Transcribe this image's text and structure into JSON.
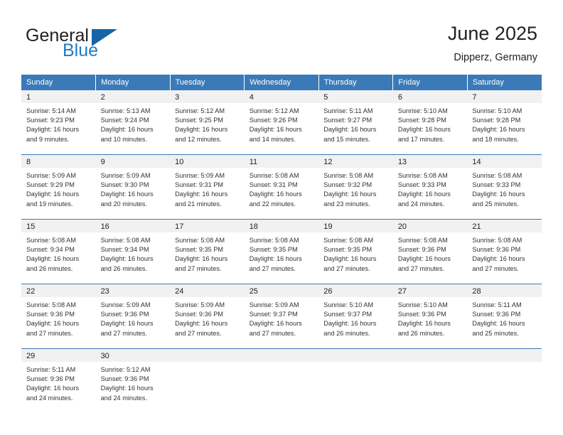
{
  "logo": {
    "word_one": "General",
    "word_two": "Blue",
    "triangle_icon": "triangle-icon"
  },
  "header": {
    "title": "June 2025",
    "subtitle": "Dipperz, Germany"
  },
  "colors": {
    "header_blue": "#3a7ab8",
    "logo_blue": "#1f7bc1",
    "daynum_background": "#f1f1f1",
    "text": "#333333"
  },
  "calendar": {
    "weekday_headers": [
      "Sunday",
      "Monday",
      "Tuesday",
      "Wednesday",
      "Thursday",
      "Friday",
      "Saturday"
    ],
    "labels": {
      "sunrise": "Sunrise:",
      "sunset": "Sunset:",
      "daylight": "Daylight:"
    },
    "weeks": [
      [
        {
          "day": "1",
          "sunrise": "Sunrise: 5:14 AM",
          "sunset": "Sunset: 9:23 PM",
          "daylight_1": "Daylight: 16 hours",
          "daylight_2": "and 9 minutes."
        },
        {
          "day": "2",
          "sunrise": "Sunrise: 5:13 AM",
          "sunset": "Sunset: 9:24 PM",
          "daylight_1": "Daylight: 16 hours",
          "daylight_2": "and 10 minutes."
        },
        {
          "day": "3",
          "sunrise": "Sunrise: 5:12 AM",
          "sunset": "Sunset: 9:25 PM",
          "daylight_1": "Daylight: 16 hours",
          "daylight_2": "and 12 minutes."
        },
        {
          "day": "4",
          "sunrise": "Sunrise: 5:12 AM",
          "sunset": "Sunset: 9:26 PM",
          "daylight_1": "Daylight: 16 hours",
          "daylight_2": "and 14 minutes."
        },
        {
          "day": "5",
          "sunrise": "Sunrise: 5:11 AM",
          "sunset": "Sunset: 9:27 PM",
          "daylight_1": "Daylight: 16 hours",
          "daylight_2": "and 15 minutes."
        },
        {
          "day": "6",
          "sunrise": "Sunrise: 5:10 AM",
          "sunset": "Sunset: 9:28 PM",
          "daylight_1": "Daylight: 16 hours",
          "daylight_2": "and 17 minutes."
        },
        {
          "day": "7",
          "sunrise": "Sunrise: 5:10 AM",
          "sunset": "Sunset: 9:28 PM",
          "daylight_1": "Daylight: 16 hours",
          "daylight_2": "and 18 minutes."
        }
      ],
      [
        {
          "day": "8",
          "sunrise": "Sunrise: 5:09 AM",
          "sunset": "Sunset: 9:29 PM",
          "daylight_1": "Daylight: 16 hours",
          "daylight_2": "and 19 minutes."
        },
        {
          "day": "9",
          "sunrise": "Sunrise: 5:09 AM",
          "sunset": "Sunset: 9:30 PM",
          "daylight_1": "Daylight: 16 hours",
          "daylight_2": "and 20 minutes."
        },
        {
          "day": "10",
          "sunrise": "Sunrise: 5:09 AM",
          "sunset": "Sunset: 9:31 PM",
          "daylight_1": "Daylight: 16 hours",
          "daylight_2": "and 21 minutes."
        },
        {
          "day": "11",
          "sunrise": "Sunrise: 5:08 AM",
          "sunset": "Sunset: 9:31 PM",
          "daylight_1": "Daylight: 16 hours",
          "daylight_2": "and 22 minutes."
        },
        {
          "day": "12",
          "sunrise": "Sunrise: 5:08 AM",
          "sunset": "Sunset: 9:32 PM",
          "daylight_1": "Daylight: 16 hours",
          "daylight_2": "and 23 minutes."
        },
        {
          "day": "13",
          "sunrise": "Sunrise: 5:08 AM",
          "sunset": "Sunset: 9:33 PM",
          "daylight_1": "Daylight: 16 hours",
          "daylight_2": "and 24 minutes."
        },
        {
          "day": "14",
          "sunrise": "Sunrise: 5:08 AM",
          "sunset": "Sunset: 9:33 PM",
          "daylight_1": "Daylight: 16 hours",
          "daylight_2": "and 25 minutes."
        }
      ],
      [
        {
          "day": "15",
          "sunrise": "Sunrise: 5:08 AM",
          "sunset": "Sunset: 9:34 PM",
          "daylight_1": "Daylight: 16 hours",
          "daylight_2": "and 26 minutes."
        },
        {
          "day": "16",
          "sunrise": "Sunrise: 5:08 AM",
          "sunset": "Sunset: 9:34 PM",
          "daylight_1": "Daylight: 16 hours",
          "daylight_2": "and 26 minutes."
        },
        {
          "day": "17",
          "sunrise": "Sunrise: 5:08 AM",
          "sunset": "Sunset: 9:35 PM",
          "daylight_1": "Daylight: 16 hours",
          "daylight_2": "and 27 minutes."
        },
        {
          "day": "18",
          "sunrise": "Sunrise: 5:08 AM",
          "sunset": "Sunset: 9:35 PM",
          "daylight_1": "Daylight: 16 hours",
          "daylight_2": "and 27 minutes."
        },
        {
          "day": "19",
          "sunrise": "Sunrise: 5:08 AM",
          "sunset": "Sunset: 9:35 PM",
          "daylight_1": "Daylight: 16 hours",
          "daylight_2": "and 27 minutes."
        },
        {
          "day": "20",
          "sunrise": "Sunrise: 5:08 AM",
          "sunset": "Sunset: 9:36 PM",
          "daylight_1": "Daylight: 16 hours",
          "daylight_2": "and 27 minutes."
        },
        {
          "day": "21",
          "sunrise": "Sunrise: 5:08 AM",
          "sunset": "Sunset: 9:36 PM",
          "daylight_1": "Daylight: 16 hours",
          "daylight_2": "and 27 minutes."
        }
      ],
      [
        {
          "day": "22",
          "sunrise": "Sunrise: 5:08 AM",
          "sunset": "Sunset: 9:36 PM",
          "daylight_1": "Daylight: 16 hours",
          "daylight_2": "and 27 minutes."
        },
        {
          "day": "23",
          "sunrise": "Sunrise: 5:09 AM",
          "sunset": "Sunset: 9:36 PM",
          "daylight_1": "Daylight: 16 hours",
          "daylight_2": "and 27 minutes."
        },
        {
          "day": "24",
          "sunrise": "Sunrise: 5:09 AM",
          "sunset": "Sunset: 9:36 PM",
          "daylight_1": "Daylight: 16 hours",
          "daylight_2": "and 27 minutes."
        },
        {
          "day": "25",
          "sunrise": "Sunrise: 5:09 AM",
          "sunset": "Sunset: 9:37 PM",
          "daylight_1": "Daylight: 16 hours",
          "daylight_2": "and 27 minutes."
        },
        {
          "day": "26",
          "sunrise": "Sunrise: 5:10 AM",
          "sunset": "Sunset: 9:37 PM",
          "daylight_1": "Daylight: 16 hours",
          "daylight_2": "and 26 minutes."
        },
        {
          "day": "27",
          "sunrise": "Sunrise: 5:10 AM",
          "sunset": "Sunset: 9:36 PM",
          "daylight_1": "Daylight: 16 hours",
          "daylight_2": "and 26 minutes."
        },
        {
          "day": "28",
          "sunrise": "Sunrise: 5:11 AM",
          "sunset": "Sunset: 9:36 PM",
          "daylight_1": "Daylight: 16 hours",
          "daylight_2": "and 25 minutes."
        }
      ],
      [
        {
          "day": "29",
          "sunrise": "Sunrise: 5:11 AM",
          "sunset": "Sunset: 9:36 PM",
          "daylight_1": "Daylight: 16 hours",
          "daylight_2": "and 24 minutes."
        },
        {
          "day": "30",
          "sunrise": "Sunrise: 5:12 AM",
          "sunset": "Sunset: 9:36 PM",
          "daylight_1": "Daylight: 16 hours",
          "daylight_2": "and 24 minutes."
        },
        {
          "day": "",
          "sunrise": "",
          "sunset": "",
          "daylight_1": "",
          "daylight_2": ""
        },
        {
          "day": "",
          "sunrise": "",
          "sunset": "",
          "daylight_1": "",
          "daylight_2": ""
        },
        {
          "day": "",
          "sunrise": "",
          "sunset": "",
          "daylight_1": "",
          "daylight_2": ""
        },
        {
          "day": "",
          "sunrise": "",
          "sunset": "",
          "daylight_1": "",
          "daylight_2": ""
        },
        {
          "day": "",
          "sunrise": "",
          "sunset": "",
          "daylight_1": "",
          "daylight_2": ""
        }
      ]
    ]
  }
}
